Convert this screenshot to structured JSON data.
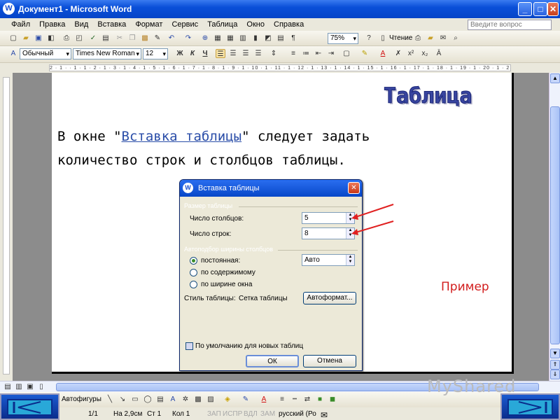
{
  "window": {
    "title": "Документ1 - Microsoft Word",
    "minimize": "_",
    "maximize": "□",
    "close": "✕",
    "app_icon": "W"
  },
  "menu": {
    "items": [
      "Файл",
      "Правка",
      "Вид",
      "Вставка",
      "Формат",
      "Сервис",
      "Таблица",
      "Окно",
      "Справка"
    ],
    "help_box": "Введите вопрос"
  },
  "toolbar_standard": {
    "zoom": "75%",
    "read_label": "Чтение"
  },
  "toolbar_format": {
    "style": "Обычный",
    "font": "Times New Roman",
    "size": "12",
    "bold": "Ж",
    "italic": "К",
    "underline": "Ч"
  },
  "ruler": {
    "marks": "2 · 1 · · 1 · 1 · 2 · 1 · 3 · 1 · 4 · 1 · 5 · 1 · 6 · 1 · 7 · 1 · 8 · 1 · 9 · 1 · 10 · 1 · 11 · 1 · 12 · 1 · 13 · 1 · 14 · 1 · 15 · 1 · 16 · 1 · 17 · 1 · 18 · 1 · 19 · 1 · 20 · 1 · 21 · 1 · 22 · 1 · 23 · 1 · 24 · 1 · 26 · 1 · 27 ·"
  },
  "document": {
    "heading": "Таблица",
    "line1_before": "В окне \"",
    "line1_link": "Вставка таблицы",
    "line1_after": "\" следует задать",
    "line2": "количество строк и столбцов таблицы.",
    "example": "Пример"
  },
  "dialog": {
    "title": "Вставка таблицы",
    "group_size": "Размер таблицы",
    "cols_label": "Число столбцов:",
    "cols_value": "5",
    "rows_label": "Число строк:",
    "rows_value": "8",
    "group_autofit": "Автоподбор ширины столбцов",
    "radio_fixed": "постоянная:",
    "fixed_value": "Авто",
    "radio_content": "по содержимому",
    "radio_window": "по ширине окна",
    "style_label": "Стиль таблицы:",
    "style_value": "Сетка таблицы",
    "autoformat_button": "Автоформат...",
    "default_checkbox": "По умолчанию для новых таблиц",
    "ok_button": "ОК",
    "cancel_button": "Отмена"
  },
  "drawbar": {
    "autoshapes": "Автофигуры"
  },
  "status": {
    "page": "1/1",
    "at": "На 2,9см",
    "line": "Ст 1",
    "col": "Кол 1",
    "rec": "ЗАП",
    "trk": "ИСПР",
    "ext": "ВДЛ",
    "ovr": "ЗАМ",
    "lang": "русский (Ро"
  },
  "watermark": "MyShared",
  "colors": {
    "title_bar": "#0a4fd8",
    "heading": "#3845a0",
    "example": "#d21e1e",
    "arrow": "#e02020",
    "nav_button": "#29a8d8"
  }
}
